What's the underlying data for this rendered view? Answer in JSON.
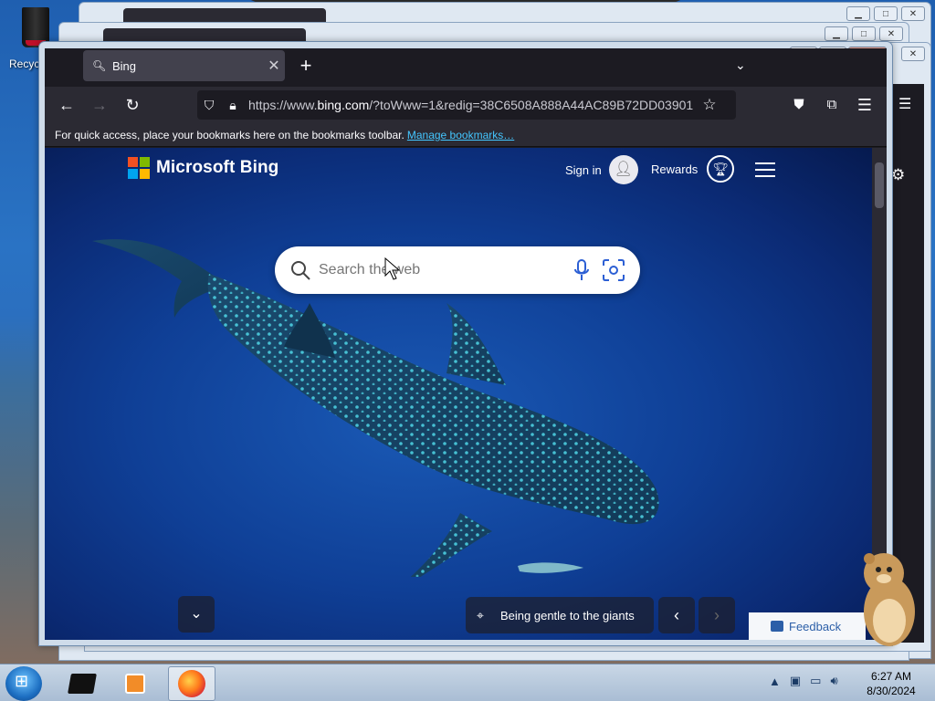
{
  "desktop": {
    "recycle_bin_label": "Recyc"
  },
  "browser": {
    "tab": {
      "title": "Bing"
    },
    "url": {
      "prefix": "https://www.",
      "host": "bing.com",
      "rest": "/?toWww=1&redig=38C6508A888A44AC89B72DD03901"
    },
    "bookmarks_bar": {
      "message": "For quick access, place your bookmarks here on the bookmarks toolbar.",
      "link": "Manage bookmarks…"
    }
  },
  "bing": {
    "logo_text": "Microsoft Bing",
    "sign_in": "Sign in",
    "rewards": "Rewards",
    "search": {
      "placeholder": "Search the web",
      "value": ""
    },
    "caption": "Being gentle to the giants",
    "feedback": "Feedback"
  },
  "taskbar": {
    "clock_time": "6:27 AM",
    "clock_date": "8/30/2024"
  },
  "icons": {
    "ms_logo_colors": [
      "#f25022",
      "#7fba00",
      "#00a4ef",
      "#ffb900"
    ]
  }
}
